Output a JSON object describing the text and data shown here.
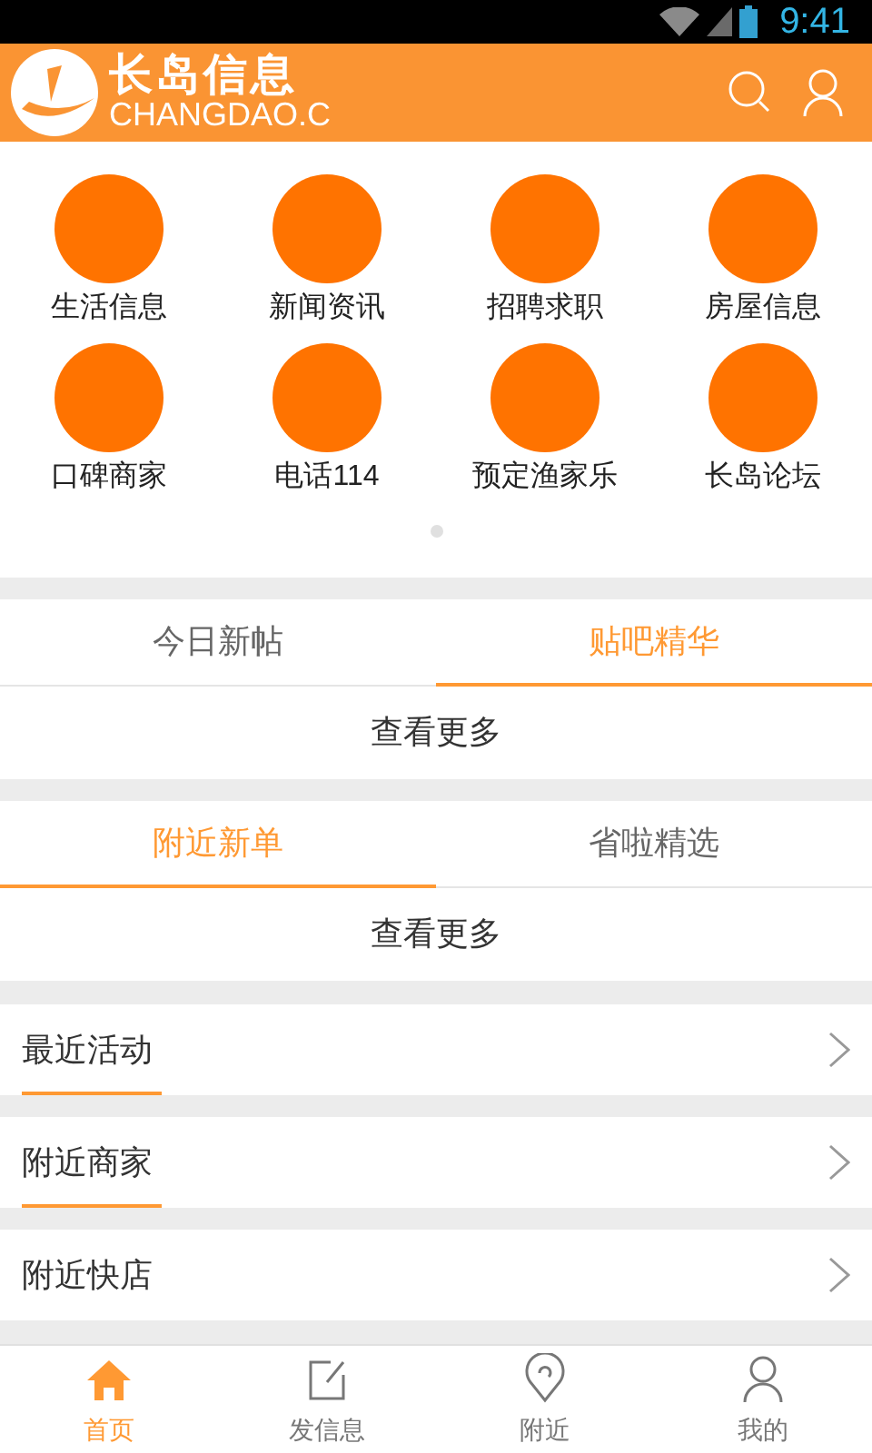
{
  "status_bar": {
    "time": "9:41"
  },
  "header": {
    "logo_title": "长岛信息",
    "logo_subtitle": "CHANGDAO.C"
  },
  "categories": [
    {
      "label": "生活信息"
    },
    {
      "label": "新闻资讯"
    },
    {
      "label": "招聘求职"
    },
    {
      "label": "房屋信息"
    },
    {
      "label": "口碑商家"
    },
    {
      "label": "电话114"
    },
    {
      "label": "预定渔家乐"
    },
    {
      "label": "长岛论坛"
    }
  ],
  "tab_groups": [
    {
      "tabs": [
        {
          "label": "今日新帖",
          "selected": false
        },
        {
          "label": "贴吧精华",
          "selected": true
        }
      ],
      "more": "查看更多"
    },
    {
      "tabs": [
        {
          "label": "附近新单",
          "selected": true
        },
        {
          "label": "省啦精选",
          "selected": false
        }
      ],
      "more": "查看更多"
    }
  ],
  "sections": [
    {
      "label": "最近活动",
      "underlined": true
    },
    {
      "label": "附近商家",
      "underlined": true
    },
    {
      "label": "附近快店",
      "underlined": false
    }
  ],
  "bottom_nav": [
    {
      "label": "首页",
      "kind": "home",
      "selected": true
    },
    {
      "label": "发信息",
      "kind": "post",
      "selected": false
    },
    {
      "label": "附近",
      "kind": "nearby",
      "selected": false
    },
    {
      "label": "我的",
      "kind": "me",
      "selected": false
    }
  ]
}
